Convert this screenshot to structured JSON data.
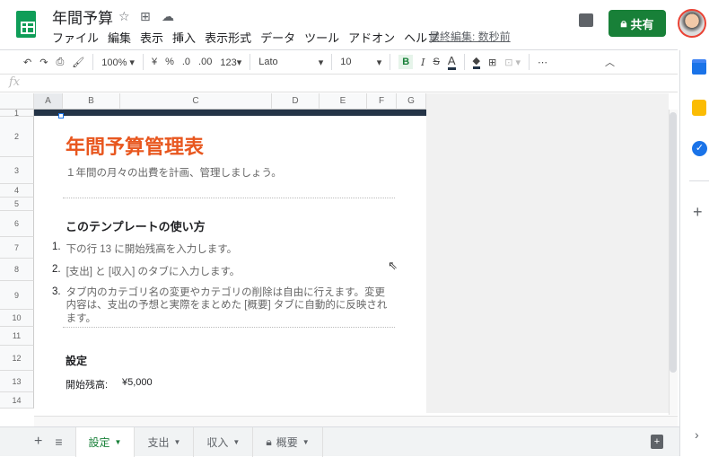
{
  "header": {
    "title": "年間予算",
    "menu": [
      "ファイル",
      "編集",
      "表示",
      "挿入",
      "表示形式",
      "データ",
      "ツール",
      "アドオン",
      "ヘルプ"
    ],
    "last_edit": "最終編集: 数秒前",
    "share_label": "共有"
  },
  "toolbar": {
    "zoom": "100%",
    "currency": "¥",
    "percent": "%",
    "dec_less": ".0",
    "dec_more": ".00",
    "format": "123",
    "font": "Lato",
    "size": "10",
    "bold": "B",
    "italic": "I",
    "strike": "S",
    "text_color": "A",
    "more": "⋯"
  },
  "formula": {
    "fx": "fx",
    "value": ""
  },
  "columns": [
    "A",
    "B",
    "C",
    "D",
    "E",
    "F",
    "G"
  ],
  "rows": [
    "1",
    "2",
    "3",
    "4",
    "5",
    "6",
    "7",
    "8",
    "9",
    "10",
    "11",
    "12",
    "13",
    "14"
  ],
  "content": {
    "title": "年間予算管理表",
    "subtitle": "１年間の月々の出費を計画、管理しましょう。",
    "howto": "このテンプレートの使い方",
    "steps": [
      {
        "n": "1.",
        "text": "下の行 13 に開始残高を入力します。"
      },
      {
        "n": "2.",
        "text": "[支出] と [収入] のタブに入力します。"
      },
      {
        "n": "3.",
        "text": "タブ内のカテゴリ名の変更やカテゴリの削除は自由に行えます。変更内容は、支出の予想と実際をまとめた [概要] タブに自動的に反映されます。"
      }
    ],
    "settings": "設定",
    "balance_label": "開始残高:",
    "balance_value": "¥5,000"
  },
  "tabs": [
    {
      "label": "設定",
      "active": true
    },
    {
      "label": "支出"
    },
    {
      "label": "収入"
    },
    {
      "label": "概要",
      "locked": true
    }
  ],
  "colors": {
    "accent": "#188038",
    "title": "#e8571f",
    "band": "#243447"
  }
}
